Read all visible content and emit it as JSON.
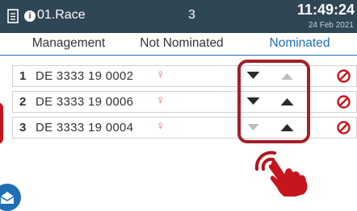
{
  "header": {
    "race_name": "01.Race",
    "race_count": "3",
    "time": "11:49:24",
    "date": "24 Feb 2021"
  },
  "tabs": [
    {
      "label": "Management",
      "active": false
    },
    {
      "label": "Not Nominated",
      "active": false
    },
    {
      "label": "Nominated",
      "active": true
    }
  ],
  "rows": [
    {
      "rank": "1",
      "pigeon": "DE 3333 19 0002",
      "gender": "♀",
      "down_enabled": true,
      "up_enabled": false
    },
    {
      "rank": "2",
      "pigeon": "DE 3333 19 0006",
      "gender": "♀",
      "down_enabled": true,
      "up_enabled": true
    },
    {
      "rank": "3",
      "pigeon": "DE 3333 19 0004",
      "gender": "♀",
      "down_enabled": false,
      "up_enabled": true
    }
  ],
  "colors": {
    "header_bg": "#2f4654",
    "accent": "#1e6fb5",
    "highlight": "#a32028",
    "remove": "#c8141c",
    "gender": "#e06a6a"
  },
  "icons": {
    "header": [
      "document-icon",
      "info-icon"
    ],
    "row_buttons": [
      "arrow-down-icon",
      "arrow-up-icon",
      "remove-icon"
    ],
    "overlay": [
      "tap-hand-icon",
      "envelope-icon"
    ]
  }
}
